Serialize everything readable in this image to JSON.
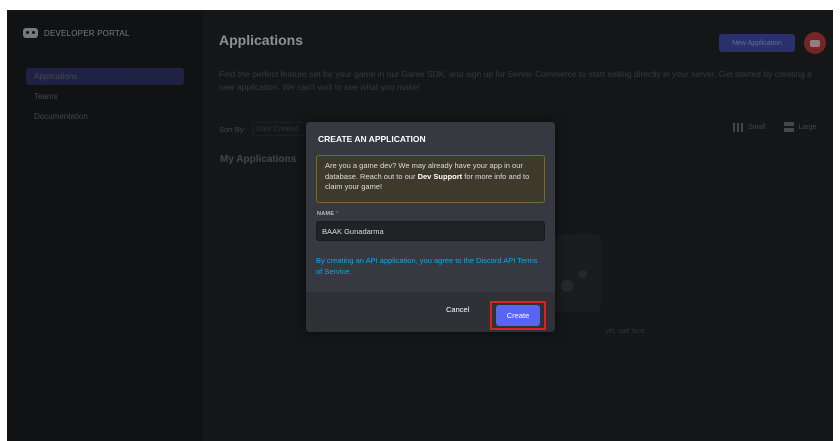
{
  "sidebar": {
    "brand": "DEVELOPER PORTAL",
    "items": [
      {
        "label": "Applications"
      },
      {
        "label": "Teams"
      },
      {
        "label": "Documentation"
      }
    ]
  },
  "header": {
    "title": "Applications",
    "new_app_label": "New Application"
  },
  "main": {
    "description": "Find the perfect feature set for your game in our Game SDK, and sign up for Server Commerce to start selling directly in your server. Get started by creating a new application. We can't wait to see what you make!",
    "sort_label": "Sort By:",
    "sort_value": "Date Created",
    "size_small": "Small",
    "size_large": "Large",
    "section_title": "My Applications",
    "empty_text": "yet, sad face."
  },
  "modal": {
    "title": "CREATE AN APPLICATION",
    "notice_pre": "Are you a game dev? We may already have your app in our database. Reach out to our ",
    "notice_bold": "Dev Support",
    "notice_post": " for more info and to claim your game!",
    "name_label": "NAME",
    "name_required": "*",
    "name_value": "BAAK Gunadarma",
    "tos_text": "By creating an API application, you agree to the Discord API Terms of Service.",
    "cancel_label": "Cancel",
    "create_label": "Create"
  },
  "colors": {
    "accent": "#5865f2",
    "highlight": "#e0201c",
    "link": "#00aff4"
  }
}
